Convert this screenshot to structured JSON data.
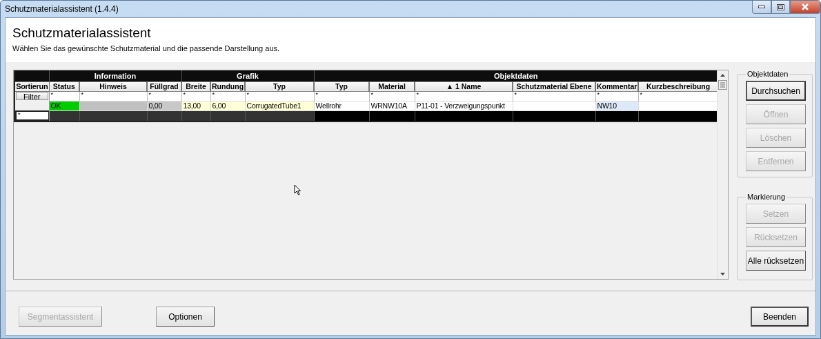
{
  "window": {
    "title": "Schutzmaterialassistent (1.4.4)"
  },
  "header": {
    "title": "Schutzmaterialassistent",
    "subtitle": "Wählen Sie das gewünschte Schutzmaterial und die passende Darstellung aus."
  },
  "grid": {
    "corner_label": "Sortierun",
    "filter_button": "Filter",
    "new_row_marker": "*",
    "groups": [
      {
        "label": "Information",
        "columns": [
          {
            "label": "Status",
            "filter": "*"
          },
          {
            "label": "Hinweis",
            "filter": "*"
          },
          {
            "label": "Füllgrad",
            "filter": "*"
          }
        ]
      },
      {
        "label": "Grafik",
        "columns": [
          {
            "label": "Breite",
            "filter": "*"
          },
          {
            "label": "Rundung",
            "filter": "*"
          },
          {
            "label": "Typ",
            "filter": "*"
          }
        ]
      },
      {
        "label": "Objektdaten",
        "columns": [
          {
            "label": "Typ",
            "filter": "*"
          },
          {
            "label": "Material",
            "filter": "*"
          },
          {
            "label": "▲ 1 Name",
            "filter": "*"
          },
          {
            "label": "Schutzmaterial Ebene",
            "filter": "*"
          },
          {
            "label": "Kommentar",
            "filter": "*"
          },
          {
            "label": "Kurzbeschreibung",
            "filter": "*"
          }
        ]
      }
    ],
    "rows": [
      {
        "cells": [
          {
            "text": "OK",
            "color": "#00cc00"
          },
          {
            "color": "#c0c0c0"
          },
          {
            "text": "0,00",
            "color": "#c8c8c8"
          },
          {
            "text": "13,00",
            "color": "#ffffd8"
          },
          {
            "text": "6,00",
            "color": "#ffffd8"
          },
          {
            "text": "CorrugatedTube1",
            "color": "#ffffd8"
          },
          {
            "text": "Wellrohr",
            "color": "#ffffff"
          },
          {
            "text": "WRNW10A",
            "color": "#ffffff"
          },
          {
            "text": "P11-01 - Verzweigungspunkt",
            "color": "#ffffff"
          },
          {
            "color": "#ffffff"
          },
          {
            "text": "NW10",
            "color": "#dde8f8"
          },
          {
            "color": "#ffffff"
          }
        ]
      }
    ]
  },
  "side_groups": [
    {
      "title": "Objektdaten",
      "buttons": [
        {
          "label": "Durchsuchen",
          "disabled": false,
          "default": true
        },
        {
          "label": "Öffnen",
          "disabled": true,
          "default": false
        },
        {
          "label": "Löschen",
          "disabled": true,
          "default": false
        },
        {
          "label": "Entfernen",
          "disabled": true,
          "default": false
        }
      ]
    },
    {
      "title": "Markierung",
      "buttons": [
        {
          "label": "Setzen",
          "disabled": true,
          "default": false
        },
        {
          "label": "Rücksetzen",
          "disabled": true,
          "default": false
        },
        {
          "label": "Alle rücksetzen",
          "disabled": false,
          "default": false
        }
      ]
    }
  ],
  "footer": {
    "buttons": [
      {
        "label": "Segmentassistent",
        "disabled": true,
        "default": false
      },
      {
        "label": "Optionen",
        "disabled": false,
        "default": false
      },
      {
        "label": "Beenden",
        "disabled": false,
        "default": true
      }
    ]
  }
}
